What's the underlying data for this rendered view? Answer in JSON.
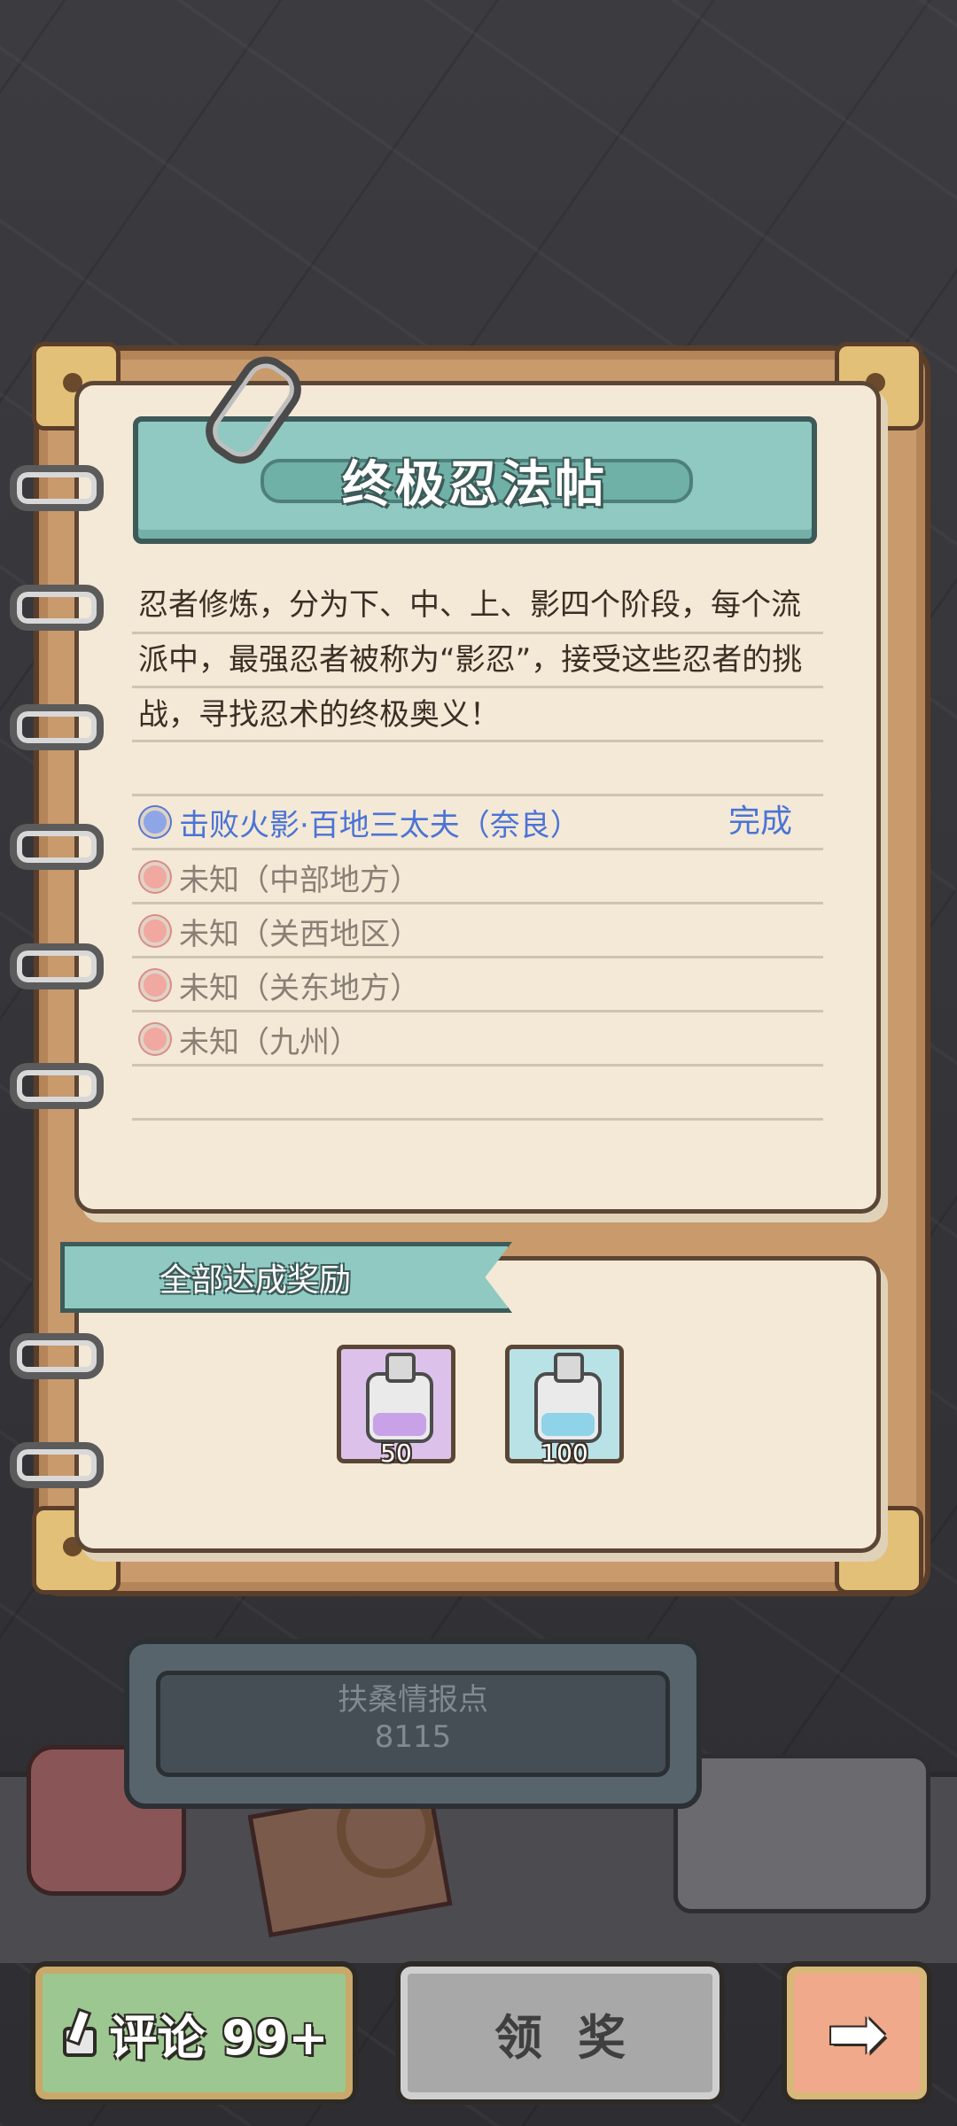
{
  "title": "终极忍法帖",
  "description": "忍者修炼，分为下、中、上、影四个阶段，每个流派中，最强忍者被称为“影忍”，接受这些忍者的挑战，寻找忍术的终极奥义！",
  "quests": [
    {
      "text": "击败火影·百地三太夫（奈良）",
      "status": "完成"
    },
    {
      "text": "未知（中部地方）"
    },
    {
      "text": "未知（关西地区）"
    },
    {
      "text": "未知（关东地方）"
    },
    {
      "text": "未知（九州）"
    }
  ],
  "reward_section": {
    "title": "全部达成奖励",
    "items": [
      {
        "icon": "purple-potion-icon",
        "qty": "50",
        "color": "#c9a1e6"
      },
      {
        "icon": "blue-potion-icon",
        "qty": "100",
        "color": "#8fd3e8"
      }
    ]
  },
  "intel": {
    "label": "扶桑情报点",
    "value": "8115"
  },
  "buttons": {
    "comment": "评论 99+",
    "claim": "领奖"
  },
  "colors": {
    "banner_teal": "#8fc9c1",
    "done_blue": "#4b73d6",
    "comment_green": "#9cc790",
    "next_orange": "#f0a98a"
  }
}
